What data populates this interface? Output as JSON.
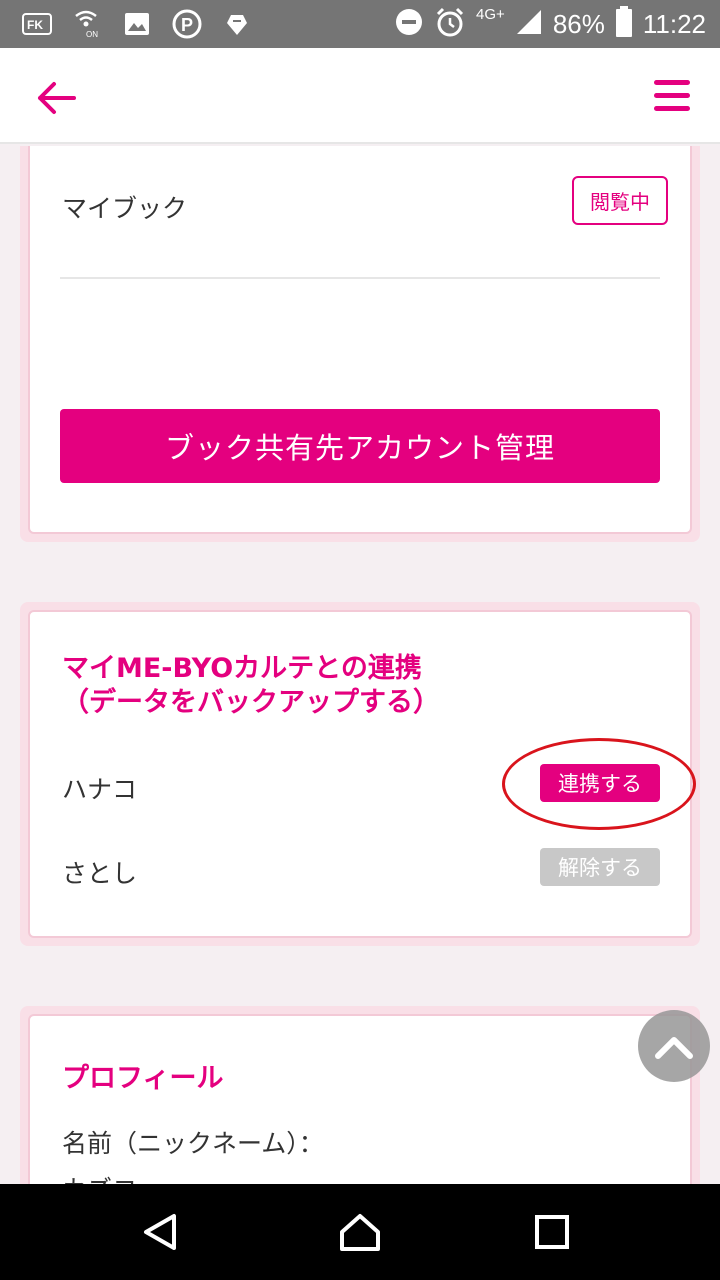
{
  "status_bar": {
    "battery": "86%",
    "time": "11:22",
    "network": "4G+",
    "icons": [
      "fk-icon",
      "wifi-calling-on-icon",
      "image-icon",
      "parking-icon",
      "game-icon",
      "minus-circle-icon",
      "alarm-icon",
      "signal-icon",
      "battery-icon"
    ]
  },
  "header": {
    "back_icon": "arrow-left-icon",
    "menu_icon": "hamburger-menu-icon",
    "accent_color": "#e4007f"
  },
  "mybook_card": {
    "label": "マイブック",
    "status_tag": "閲覧中",
    "manage_button": "ブック共有先アカウント管理"
  },
  "link_card": {
    "title_line1": "マイME-BYOカルテとの連携",
    "title_line2": "（データをバックアップする）",
    "rows": [
      {
        "name": "ハナコ",
        "action": "連携する"
      },
      {
        "name": "さとし",
        "action": "解除する"
      }
    ]
  },
  "profile_card": {
    "title": "プロフィール",
    "name_label": "名前（ニックネーム）：",
    "name_value": "カズコ"
  },
  "scroll_top_icon": "chevron-up-icon",
  "nav": {
    "back": "triangle-back-icon",
    "home": "home-icon",
    "recents": "square-recents-icon"
  }
}
